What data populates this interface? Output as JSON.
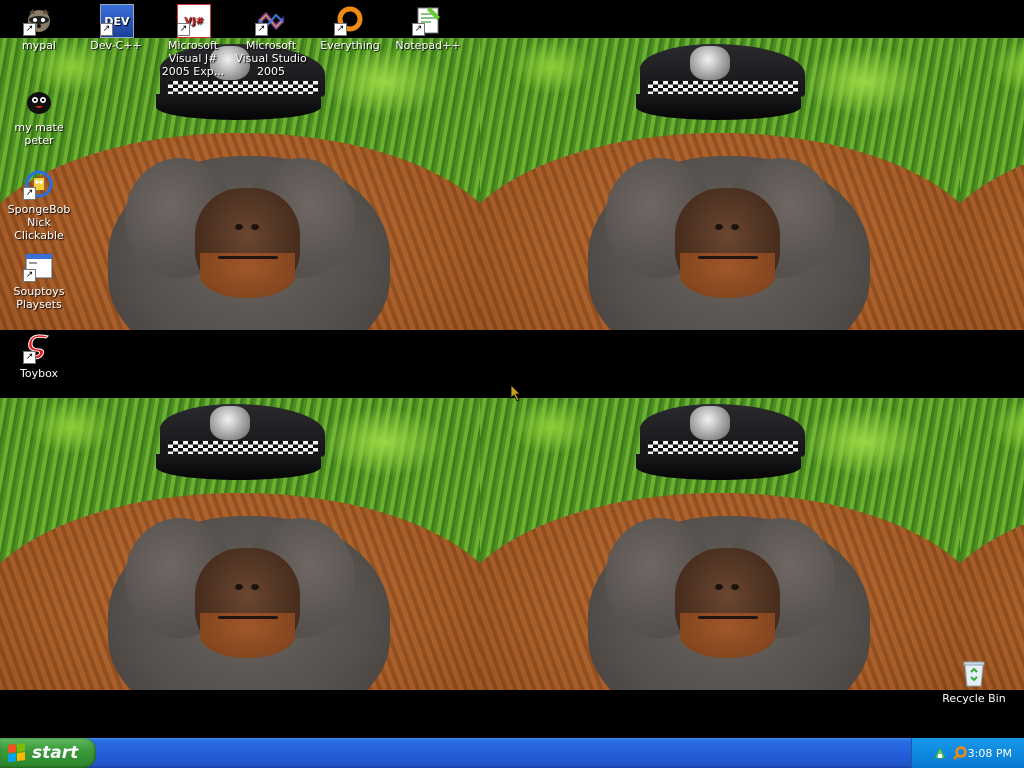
{
  "desktop": {
    "icons": [
      {
        "label": "mypal",
        "icon": "raccoon-icon"
      },
      {
        "label": "Dev-C++",
        "icon": "dev-cpp-icon"
      },
      {
        "label": "Microsoft Visual J# 2005 Exp...",
        "icon": "vjsharp-icon"
      },
      {
        "label": "Microsoft Visual Studio 2005",
        "icon": "visual-studio-icon"
      },
      {
        "label": "Everything",
        "icon": "everything-icon"
      },
      {
        "label": "Notepad++",
        "icon": "notepadpp-icon"
      },
      {
        "label": "my mate peter",
        "icon": "black-bird-icon"
      },
      {
        "label": "SpongeBob Nick Clickable",
        "icon": "spongebob-icon"
      },
      {
        "label": "Souptoys Playsets",
        "icon": "window-icon"
      },
      {
        "label": "Toybox",
        "icon": "red-s-icon"
      },
      {
        "label": "Recycle Bin",
        "icon": "recycle-bin-icon"
      }
    ],
    "dev_icon_text": "DEV",
    "vj_icon_text": "VJ#",
    "shortcut_arrow": "↗"
  },
  "taskbar": {
    "start_label": "start",
    "clock": "3:08 PM",
    "colors": {
      "start": "#3c9a3c",
      "bar": "#245edb",
      "tray": "#0f8ae0"
    }
  }
}
